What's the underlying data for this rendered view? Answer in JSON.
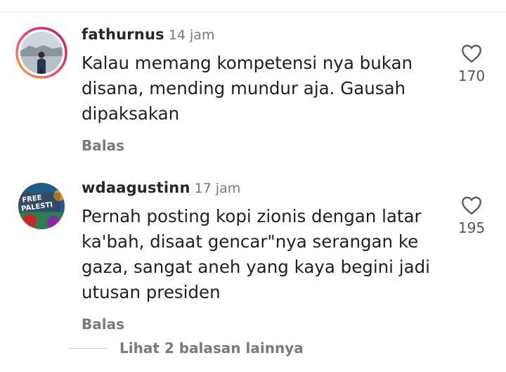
{
  "comments": [
    {
      "username": "fathurnus",
      "time": "14 jam",
      "text_lines": [
        "Kalau memang kompetensi nya bukan",
        "disana, mending mundur aja. Gausah",
        "dipaksakan"
      ],
      "reply_label": "Balas",
      "likes": "170",
      "avatar_icon": "person-photo-avatar-with-story-ring"
    },
    {
      "username": "wdaagustinn",
      "time": "17 jam",
      "text_lines": [
        "Pernah posting kopi zionis dengan latar",
        "ka'bah, disaat gencar\"nya serangan ke",
        "gaza, sangat aneh yang kaya begini jadi",
        "utusan presiden"
      ],
      "reply_label": "Balas",
      "likes": "195",
      "avatar_icon": "free-palestine-avatar",
      "avatar_text": [
        "FREE",
        "PALESTI"
      ]
    }
  ],
  "view_more_replies": "Lihat 2 balasan lainnya",
  "colors": {
    "story_ring_start": "#f9a825",
    "story_ring_end": "#d81b60",
    "username": "#262626",
    "secondary_text": "#7a7a7a"
  },
  "icons": {
    "like": "heart-outline-icon"
  }
}
